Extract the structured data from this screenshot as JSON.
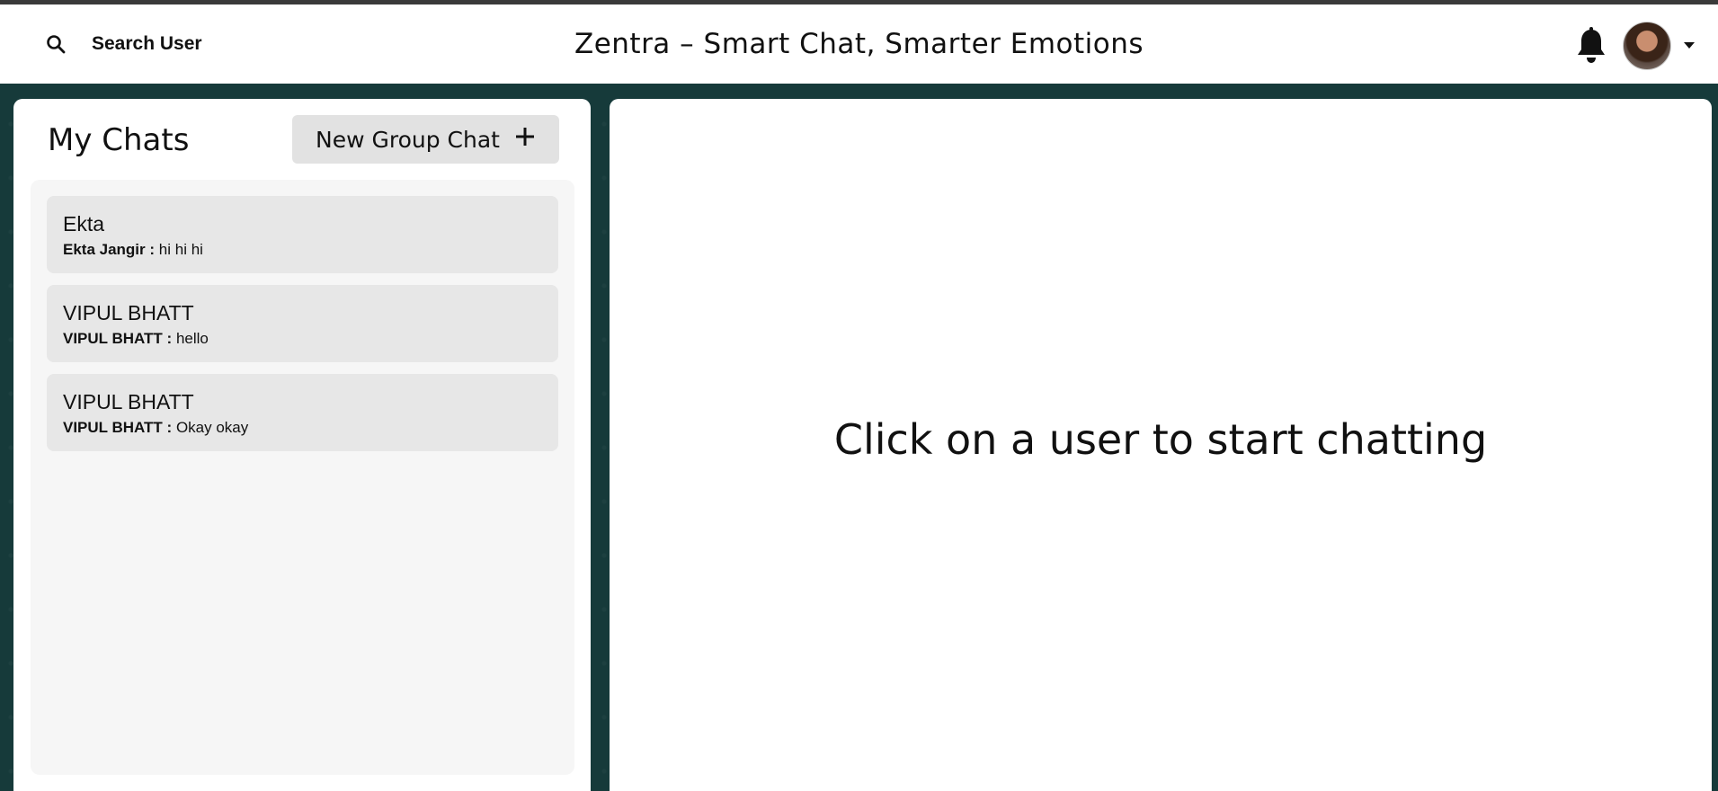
{
  "header": {
    "search_label": "Search User",
    "title": "Zentra – Smart Chat, Smarter Emotions",
    "icons": {
      "search": "search-icon",
      "notifications": "bell-icon",
      "avatar": "user-avatar",
      "menu": "chevron-down-icon"
    }
  },
  "sidebar": {
    "title": "My Chats",
    "new_group_label": "New Group Chat",
    "new_group_icon": "plus-icon",
    "chats": [
      {
        "name": "Ekta",
        "sender": "Ekta Jangir :",
        "message": "hi hi hi"
      },
      {
        "name": "VIPUL BHATT",
        "sender": "VIPUL BHATT :",
        "message": "hello"
      },
      {
        "name": "VIPUL BHATT",
        "sender": "VIPUL BHATT :",
        "message": "Okay okay"
      }
    ]
  },
  "main": {
    "empty_state": "Click on a user to start chatting"
  },
  "colors": {
    "background": "#163a3a",
    "panel": "#ffffff",
    "chat_list_bg": "#f6f6f6",
    "chat_item_bg": "#e7e7e7",
    "button_bg": "#e2e2e2"
  }
}
